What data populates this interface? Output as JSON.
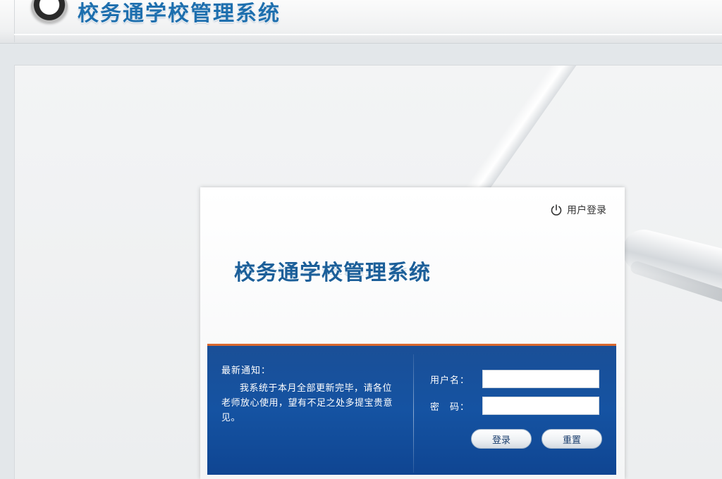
{
  "header": {
    "app_title": "校务通学校管理系统"
  },
  "login": {
    "user_login_link": "用户登录",
    "system_title": "校务通学校管理系统",
    "notice": {
      "title": "最新通知：",
      "body": "我系统于本月全部更新完毕，请各位老师放心使用，望有不足之处多提宝贵意见。"
    },
    "username_label": "用户名：",
    "password_label": "密　码：",
    "username_value": "",
    "password_value": "",
    "login_button": "登录",
    "reset_button": "重置"
  },
  "colors": {
    "title_blue": "#1e6fae",
    "band_blue": "#1553a2",
    "band_accent": "#d9682f"
  },
  "icons": {
    "logo": "ring-logo-icon",
    "user_login": "power-icon"
  }
}
